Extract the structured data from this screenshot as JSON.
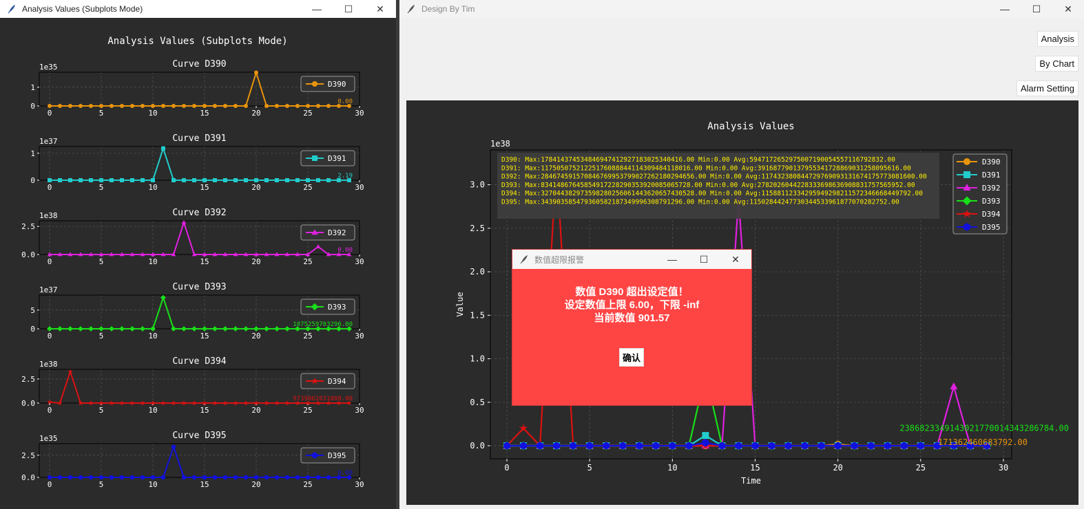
{
  "win1": {
    "title": "Analysis Values (Subplots Mode)",
    "fig_title": "Analysis Values (Subplots Mode)"
  },
  "win2": {
    "title": "Design By Tim",
    "buttons": {
      "analysis": "Analysis",
      "by_chart": "By Chart",
      "alarm": "Alarm Setting"
    }
  },
  "window_controls": {
    "minimize": "—",
    "maximize": "☐",
    "close": "✕"
  },
  "dialog": {
    "title": "数值超限报警",
    "line1": "数值 D390 超出设定值！",
    "line2": "设定数值上限 6.00，下限 -inf",
    "line3": "当前数值 901.57",
    "ok": "确认"
  },
  "colors": {
    "D390": "#e8940c",
    "D391": "#22cccc",
    "D392": "#e020e0",
    "D393": "#18e018",
    "D394": "#dd1111",
    "D395": "#1111dd",
    "bg": "#2b2b2b",
    "axes": "#2b2b2b",
    "text": "#ffffff",
    "grid": "#555555",
    "dialog": "#ff4444"
  },
  "chart_data": [
    {
      "type": "line",
      "title": "Curve D390",
      "name": "D390",
      "marker": "circle",
      "exponent": "1e35",
      "ylim": [
        0,
        1.8
      ],
      "yticks": [
        0,
        1
      ],
      "xlim": [
        -1,
        30
      ],
      "xticks": [
        0,
        5,
        10,
        15,
        20,
        25,
        30
      ],
      "legend": "right",
      "end_label": "0.00",
      "x": [
        0,
        1,
        2,
        3,
        4,
        5,
        6,
        7,
        8,
        9,
        10,
        11,
        12,
        13,
        14,
        15,
        16,
        17,
        18,
        19,
        20,
        21,
        22,
        23,
        24,
        25,
        26,
        27,
        28,
        29
      ],
      "y": [
        0,
        0,
        0,
        0,
        0,
        0,
        0,
        0,
        0,
        0,
        0,
        0,
        0,
        0,
        0,
        0,
        0,
        0,
        0,
        0,
        1.78,
        0,
        0,
        0,
        0,
        0,
        0,
        0,
        0,
        0
      ]
    },
    {
      "type": "line",
      "title": "Curve D391",
      "name": "D391",
      "marker": "square",
      "exponent": "1e37",
      "ylim": [
        0,
        1.25
      ],
      "yticks": [
        0,
        1
      ],
      "xlim": [
        -1,
        30
      ],
      "xticks": [
        0,
        5,
        10,
        15,
        20,
        25,
        30
      ],
      "legend": "right",
      "end_label": "2.19",
      "x": [
        0,
        1,
        2,
        3,
        4,
        5,
        6,
        7,
        8,
        9,
        10,
        11,
        12,
        13,
        14,
        15,
        16,
        17,
        18,
        19,
        20,
        21,
        22,
        23,
        24,
        25,
        26,
        27,
        28,
        29
      ],
      "y": [
        0,
        0,
        0,
        0,
        0,
        0,
        0,
        0,
        0,
        0,
        0,
        1.18,
        0,
        0,
        0,
        0,
        0,
        0,
        0,
        0,
        0,
        0,
        0,
        0,
        0,
        0,
        0,
        0,
        0,
        0
      ]
    },
    {
      "type": "line",
      "title": "Curve D392",
      "name": "D392",
      "marker": "triangle",
      "exponent": "1e38",
      "ylim": [
        0,
        3.0
      ],
      "yticks": [
        0.0,
        2.5
      ],
      "tick_format": "fixed1",
      "xlim": [
        -1,
        30
      ],
      "xticks": [
        0,
        5,
        10,
        15,
        20,
        25,
        30
      ],
      "legend": "right",
      "end_label": "0.00",
      "x": [
        0,
        1,
        2,
        3,
        4,
        5,
        6,
        7,
        8,
        9,
        10,
        11,
        12,
        13,
        14,
        15,
        16,
        17,
        18,
        19,
        20,
        21,
        22,
        23,
        24,
        25,
        26,
        27,
        28,
        29
      ],
      "y": [
        0,
        0,
        0,
        0,
        0,
        0,
        0,
        0,
        0,
        0,
        0,
        0,
        0,
        2.85,
        0,
        0,
        0,
        0,
        0,
        0,
        0,
        0,
        0,
        0,
        0,
        0,
        0.7,
        0,
        0,
        0
      ]
    },
    {
      "type": "line",
      "title": "Curve D393",
      "name": "D393",
      "marker": "diamond",
      "exponent": "1e37",
      "ylim": [
        0,
        9.0
      ],
      "yticks": [
        0,
        5
      ],
      "xlim": [
        -1,
        30
      ],
      "xticks": [
        0,
        5,
        10,
        15,
        20,
        25,
        30
      ],
      "legend": "right",
      "end_label": "1075259703296.00",
      "x": [
        0,
        1,
        2,
        3,
        4,
        5,
        6,
        7,
        8,
        9,
        10,
        11,
        12,
        13,
        14,
        15,
        16,
        17,
        18,
        19,
        20,
        21,
        22,
        23,
        24,
        25,
        26,
        27,
        28,
        29
      ],
      "y": [
        0,
        0,
        0,
        0,
        0,
        0,
        0,
        0,
        0,
        0,
        0,
        8.34,
        0,
        0,
        0,
        0,
        0,
        0,
        0,
        0,
        0,
        0,
        0,
        0,
        0,
        0,
        0,
        0,
        0,
        0
      ]
    },
    {
      "type": "line",
      "title": "Curve D394",
      "name": "D394",
      "marker": "star",
      "exponent": "1e38",
      "ylim": [
        0,
        3.5
      ],
      "yticks": [
        0.0,
        2.5
      ],
      "tick_format": "fixed1",
      "xlim": [
        -1,
        30
      ],
      "xticks": [
        0,
        5,
        10,
        15,
        20,
        25,
        30
      ],
      "legend": "right",
      "end_label": "9739862831808.00",
      "x": [
        0,
        1,
        2,
        3,
        4,
        5,
        6,
        7,
        8,
        9,
        10,
        11,
        12,
        13,
        14,
        15,
        16,
        17,
        18,
        19,
        20,
        21,
        22,
        23,
        24,
        25,
        26,
        27,
        28,
        29
      ],
      "y": [
        0.1,
        0,
        3.27,
        0,
        0,
        0,
        0,
        0,
        0,
        0,
        0,
        0,
        0,
        0,
        0,
        0,
        0,
        0,
        0,
        0,
        0,
        0,
        0,
        0,
        0,
        0,
        0,
        0,
        0,
        0
      ]
    },
    {
      "type": "line",
      "title": "Curve D395",
      "name": "D395",
      "marker": "hexagon",
      "exponent": "1e35",
      "ylim": [
        0,
        3.8
      ],
      "yticks": [
        0.0,
        2.5
      ],
      "tick_format": "fixed1",
      "xlim": [
        -1,
        30
      ],
      "xticks": [
        0,
        5,
        10,
        15,
        20,
        25,
        30
      ],
      "legend": "right",
      "end_label": "0.00",
      "x": [
        0,
        1,
        2,
        3,
        4,
        5,
        6,
        7,
        8,
        9,
        10,
        11,
        12,
        13,
        14,
        15,
        16,
        17,
        18,
        19,
        20,
        21,
        22,
        23,
        24,
        25,
        26,
        27,
        28,
        29
      ],
      "y": [
        0,
        0,
        0,
        0,
        0,
        0,
        0,
        0,
        0,
        0,
        0,
        0,
        3.44,
        0,
        0,
        0,
        0,
        0,
        0,
        0,
        0,
        0,
        0,
        0,
        0,
        0,
        0,
        0,
        0,
        0
      ]
    },
    {
      "type": "line",
      "title": "Analysis Values",
      "xlabel": "Time",
      "ylabel": "Value",
      "exponent": "1e38",
      "ylim": [
        -0.15,
        3.4
      ],
      "yticks": [
        0.0,
        0.5,
        1.0,
        1.5,
        2.0,
        2.5,
        3.0
      ],
      "xlim": [
        -1,
        30.5
      ],
      "xticks": [
        0,
        5,
        10,
        15,
        20,
        25,
        30
      ],
      "grid": true,
      "legend": "top-right",
      "x": [
        0,
        1,
        2,
        3,
        4,
        5,
        6,
        7,
        8,
        9,
        10,
        11,
        12,
        13,
        14,
        15,
        16,
        17,
        18,
        19,
        20,
        21,
        22,
        23,
        24,
        25,
        26,
        27,
        28,
        29
      ],
      "series": [
        {
          "name": "D390",
          "marker": "circle",
          "y": [
            0,
            0,
            0,
            0,
            0,
            0,
            0,
            0,
            0,
            0,
            0,
            0,
            0,
            0,
            0,
            0,
            0,
            0,
            0,
            0,
            0.018,
            0,
            0,
            0,
            0,
            0,
            0,
            0,
            0,
            0
          ]
        },
        {
          "name": "D391",
          "marker": "square",
          "y": [
            0,
            0,
            0,
            0,
            0,
            0,
            0,
            0,
            0,
            0,
            0,
            0,
            0.118,
            0,
            0,
            0,
            0,
            0,
            0,
            0,
            0,
            0,
            0,
            0,
            0,
            0,
            0,
            0,
            0,
            0
          ]
        },
        {
          "name": "D392",
          "marker": "triangle",
          "y": [
            0,
            0,
            0,
            0,
            0,
            0,
            0,
            0,
            0,
            0,
            0,
            0,
            0,
            0,
            2.85,
            0,
            0,
            0,
            0,
            0,
            0,
            0,
            0,
            0,
            0,
            0,
            0,
            0.68,
            0,
            0
          ]
        },
        {
          "name": "D393",
          "marker": "diamond",
          "y": [
            0,
            0,
            0,
            0,
            0,
            0,
            0,
            0,
            0,
            0,
            0,
            0,
            0.83,
            0,
            0,
            0,
            0,
            0,
            0,
            0,
            0,
            0,
            0,
            0,
            0,
            0,
            0,
            0,
            0,
            0
          ]
        },
        {
          "name": "D394",
          "marker": "star",
          "y": [
            0,
            0.2,
            0,
            3.27,
            0,
            0,
            0,
            0,
            0,
            0,
            0,
            0,
            0,
            0,
            0,
            0,
            0,
            0,
            0,
            0,
            0,
            0,
            0,
            0,
            0,
            0,
            0,
            0,
            0,
            0
          ]
        },
        {
          "name": "D395",
          "marker": "hexagon",
          "y": [
            0,
            0,
            0,
            0,
            0,
            0,
            0,
            0,
            0,
            0,
            0,
            0,
            0.034,
            0,
            0,
            0,
            0,
            0,
            0,
            0,
            0,
            0,
            0,
            0,
            0,
            0,
            0,
            0,
            0,
            0
          ]
        }
      ],
      "stats": [
        "D390: Max:178414374534846947412927183025340416.00 Min:0.00 Avg:5947172652975007190054557116792832.00",
        "D391: Max:11750507521225176088844114309484118016.00 Min:0.00 Avg:391687790137955341728869031258095616.00",
        "D392: Max:284674591570846769953799027262180294656.00 Min:0.00 Avg:117432380844729769093131674175773081600.00",
        "D393: Max:83414867645854917228290353920085065728.00 Min:0.00 Avg:2782026044228333698636908831757565952.00",
        "D394: Max:327044382973598280256061443620657430528.00 Min:0.00 Avg:11588112334295949298211572346668449792.00",
        "D395: Max:343903585479360582187349996308791296.00 Min:0.00 Avg:11502844247730344533961877070282752.00"
      ],
      "end_labels": [
        {
          "series": "D393",
          "text": "2386823349143021770014343286784.00"
        },
        {
          "series": "D390",
          "text": "171362460683792.00"
        }
      ]
    }
  ]
}
